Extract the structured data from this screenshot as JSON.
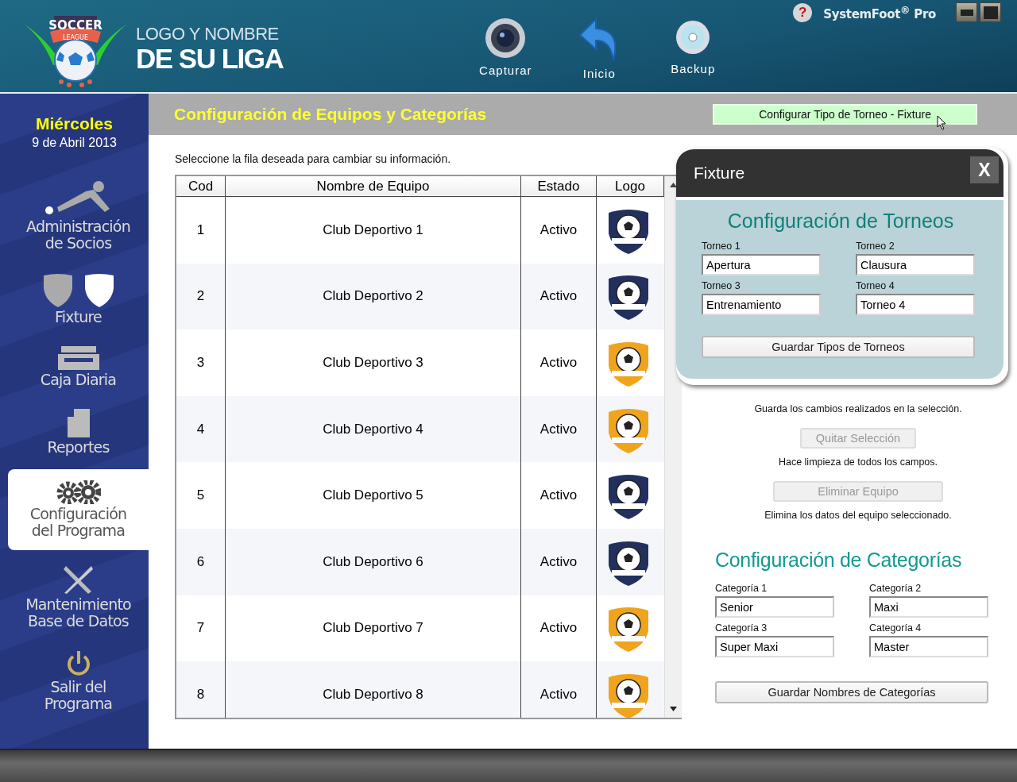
{
  "header": {
    "logo": {
      "top": "SOCCER",
      "ribbon": "LEAGUE"
    },
    "league_name": {
      "line_1": "LOGO Y NOMBRE",
      "line_2": "DE SU LIGA"
    },
    "toolbar": [
      {
        "kind": "camera",
        "label": "Capturar"
      },
      {
        "kind": "undo",
        "label": "Inicio"
      },
      {
        "kind": "disc",
        "label": "Backup"
      }
    ],
    "help": "?",
    "product": "SystemFoot$^{®}$ Pro"
  },
  "sidebar": {
    "day": "Miércoles",
    "date": "9 de Abril 2013",
    "items": [
      {
        "kind": "members",
        "label": "Administración\nde Socios",
        "selected": false
      },
      {
        "kind": "shields",
        "label": "Fixture",
        "selected": false
      },
      {
        "kind": "cash",
        "label": "Caja Diaria",
        "selected": false
      },
      {
        "kind": "report",
        "label": "Reportes",
        "selected": false
      },
      {
        "kind": "gears",
        "label": "Configuración\ndel Programa",
        "selected": true
      },
      {
        "kind": "tools",
        "label": "Mantenimiento\nBase de Datos",
        "selected": false
      },
      {
        "kind": "power",
        "label": "Salir del\nPrograma",
        "selected": false
      }
    ]
  },
  "page_title": "Configuración de Equipos y Categorías",
  "fixture_button": "Configurar Tipo de Torneo - Fixture",
  "instruction": "Seleccione la fila deseada para cambiar su información.",
  "table": {
    "columns": [
      "Cod",
      "Nombre de Equipo",
      "Estado",
      "Logo"
    ],
    "rows": [
      {
        "cod": "1",
        "name": "Club Deportivo 1",
        "status": "Activo",
        "color": "#23305e"
      },
      {
        "cod": "2",
        "name": "Club Deportivo 2",
        "status": "Activo",
        "color": "#23305e"
      },
      {
        "cod": "3",
        "name": "Club Deportivo 3",
        "status": "Activo",
        "color": "#f0a41e"
      },
      {
        "cod": "4",
        "name": "Club Deportivo 4",
        "status": "Activo",
        "color": "#f0a41e"
      },
      {
        "cod": "5",
        "name": "Club Deportivo 5",
        "status": "Activo",
        "color": "#23305e"
      },
      {
        "cod": "6",
        "name": "Club Deportivo 6",
        "status": "Activo",
        "color": "#23305e"
      },
      {
        "cod": "7",
        "name": "Club Deportivo 7",
        "status": "Activo",
        "color": "#f0a41e"
      },
      {
        "cod": "8",
        "name": "Club Deportivo 8",
        "status": "Activo",
        "color": "#f0a41e"
      }
    ]
  },
  "actions": [
    {
      "kind": "note",
      "text": "Guarda los cambios realizados en la selección."
    },
    {
      "kind": "button",
      "label": "Quitar Selección",
      "disabled": true
    },
    {
      "kind": "note",
      "text": "Hace limpieza de todos los campos."
    },
    {
      "kind": "button",
      "label": "Eliminar Equipo",
      "disabled": true
    },
    {
      "kind": "note",
      "text": "Elimina los datos del equipo seleccionado."
    }
  ],
  "categories": {
    "heading": "Configuración de Categorías",
    "fields": [
      {
        "label": "Categoría 1",
        "value": "Senior"
      },
      {
        "label": "Categoría 2",
        "value": "Maxi"
      },
      {
        "label": "Categoría 3",
        "value": "Super Maxi"
      },
      {
        "label": "Categoría 4",
        "value": "Master"
      }
    ],
    "save_button": "Guardar Nombres de Categorías"
  },
  "modal": {
    "title": "Fixture",
    "close": "X",
    "heading": "Configuración de Torneos",
    "fields": [
      {
        "label": "Torneo 1",
        "value": "Apertura"
      },
      {
        "label": "Torneo 2",
        "value": "Clausura"
      },
      {
        "label": "Torneo 3",
        "value": "Entrenamiento"
      },
      {
        "label": "Torneo 4",
        "value": "Torneo 4"
      }
    ],
    "save_button": "Guardar Tipos de Torneos"
  }
}
